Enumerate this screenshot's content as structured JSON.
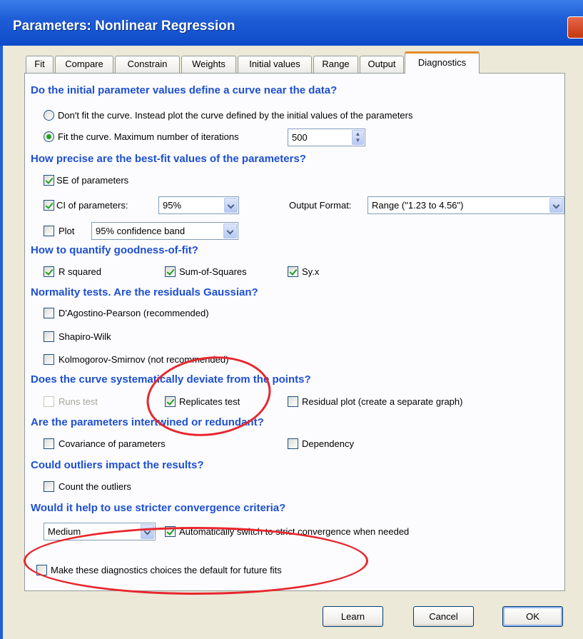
{
  "window": {
    "title": "Parameters: Nonlinear Regression"
  },
  "tabs": [
    {
      "label": "Fit"
    },
    {
      "label": "Compare"
    },
    {
      "label": "Constrain"
    },
    {
      "label": "Weights"
    },
    {
      "label": "Initial values"
    },
    {
      "label": "Range"
    },
    {
      "label": "Output"
    },
    {
      "label": "Diagnostics",
      "active": true
    }
  ],
  "sections": {
    "initial": {
      "heading": "Do the initial parameter values define a curve near the data?",
      "dont_fit_label": "Don't fit the curve. Instead plot the curve defined by the initial values of the parameters",
      "fit_label": "Fit the curve. Maximum number of iterations",
      "iterations_value": "500",
      "selected": "fit"
    },
    "precision": {
      "heading": "How precise are the best-fit values of the parameters?",
      "se_label": "SE of parameters",
      "se_checked": true,
      "ci_label": "CI of parameters:",
      "ci_checked": true,
      "ci_value": "95%",
      "output_format_label": "Output Format:",
      "output_format_value": "Range (\"1.23 to 4.56\")",
      "plot_label": "Plot",
      "plot_checked": false,
      "plot_value": "95% confidence band"
    },
    "goodness": {
      "heading": "How to quantify goodness-of-fit?",
      "r_squared_label": "R squared",
      "sum_of_squares_label": "Sum-of-Squares",
      "syx_label": "Sy.x"
    },
    "normality": {
      "heading": "Normality tests. Are the residuals Gaussian?",
      "dagostino_label": "D'Agostino-Pearson (recommended)",
      "shapiro_label": "Shapiro-Wilk",
      "kolmogorov_label": "Kolmogorov-Smirnov (not recommended)"
    },
    "deviation": {
      "heading": "Does the curve systematically deviate from the points?",
      "runs_label": "Runs test",
      "replicates_label": "Replicates test",
      "residual_plot_label": "Residual plot (create a separate graph)"
    },
    "intertwined": {
      "heading": "Are the parameters intertwined or redundant?",
      "covariance_label": "Covariance of parameters",
      "dependency_label": "Dependency"
    },
    "outliers": {
      "heading": "Could outliers impact the results?",
      "count_label": "Count the outliers"
    },
    "convergence": {
      "heading": "Would it help to use stricter convergence criteria?",
      "level_value": "Medium",
      "auto_switch_label": "Automatically switch to strict convergence when needed"
    }
  },
  "default_choice_label": "Make these diagnostics choices the default for future fits",
  "buttons": {
    "learn": "Learn",
    "cancel": "Cancel",
    "ok": "OK"
  },
  "colors": {
    "heading": "#1d4fd0",
    "annotation": "#e8262e",
    "titlebar": "#0d4bc9"
  }
}
